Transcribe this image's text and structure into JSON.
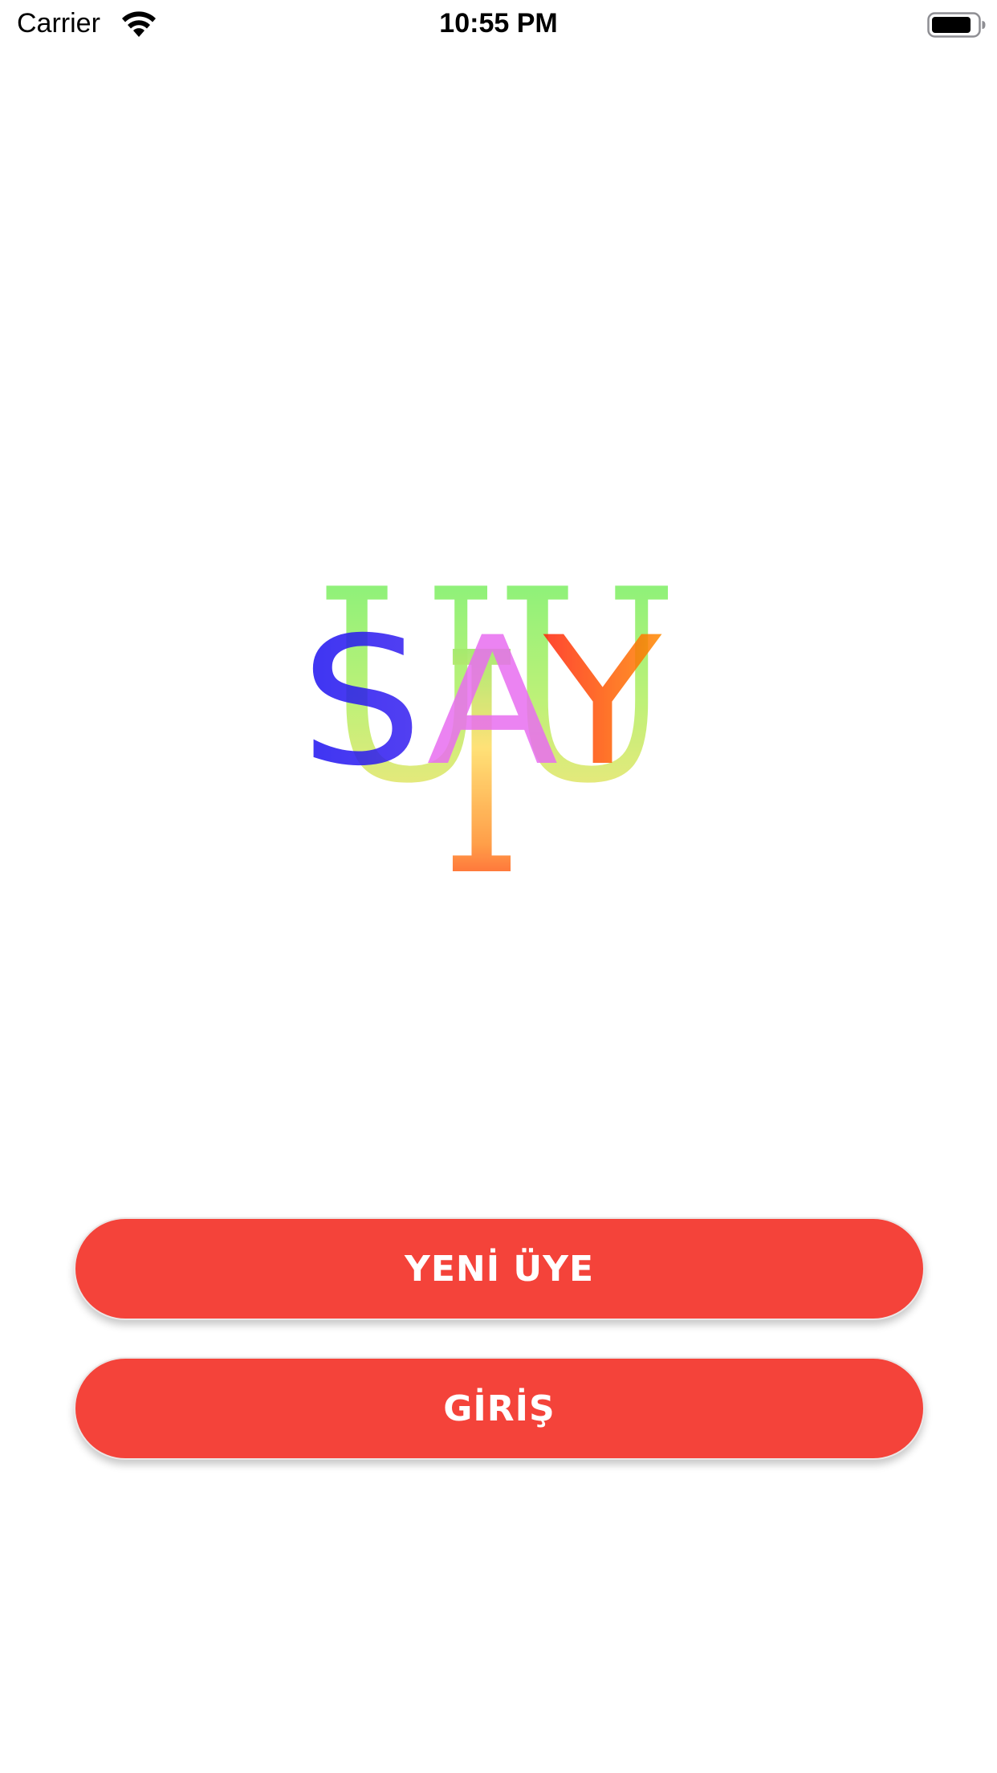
{
  "status_bar": {
    "carrier": "Carrier",
    "time": "10:55 PM",
    "wifi_icon": "wifi-icon",
    "battery_icon": "battery-icon"
  },
  "logo": {
    "letters_top": "UU",
    "letters_middle": "SAY",
    "letter_bottom": "I",
    "colors": {
      "green": "#6cf06c",
      "blue": "#1c12f0",
      "pink": "#e86ef0",
      "red": "#ff1010",
      "yellow": "#ffe060"
    }
  },
  "buttons": {
    "register_label": "YENİ ÜYE",
    "login_label": "GİRİŞ"
  },
  "theme": {
    "accent": "#f4433a",
    "background": "#ffffff"
  }
}
